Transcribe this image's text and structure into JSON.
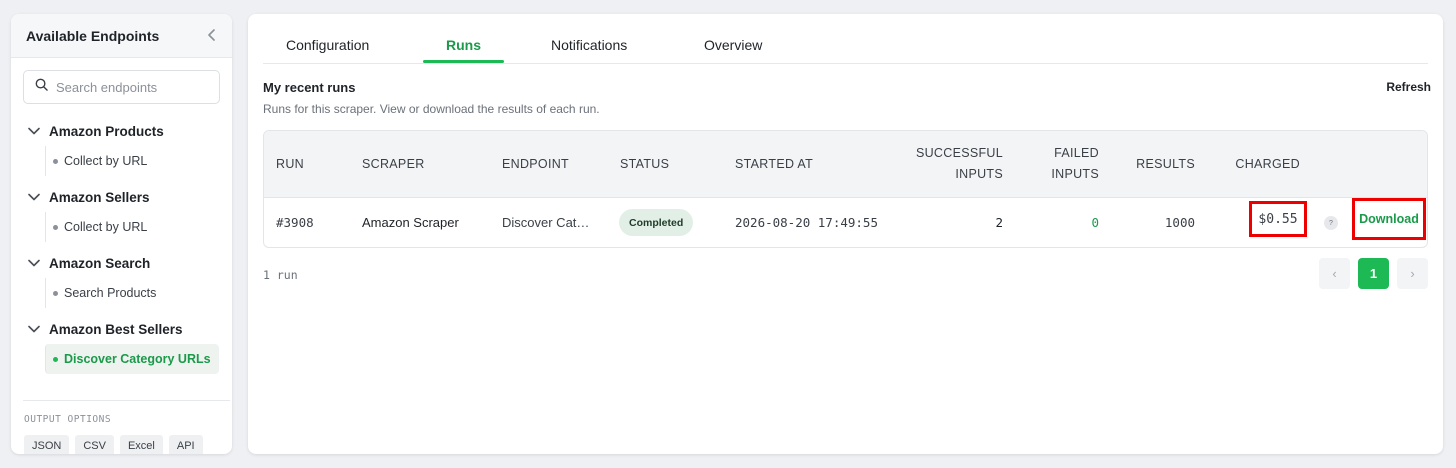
{
  "sidebar": {
    "title": "Available Endpoints",
    "search_placeholder": "Search endpoints",
    "groups": [
      {
        "label": "Amazon Products",
        "items": [
          {
            "label": "Collect by URL",
            "active": false
          }
        ]
      },
      {
        "label": "Amazon Sellers",
        "items": [
          {
            "label": "Collect by URL",
            "active": false
          }
        ]
      },
      {
        "label": "Amazon Search",
        "items": [
          {
            "label": "Search Products",
            "active": false
          }
        ]
      },
      {
        "label": "Amazon Best Sellers",
        "items": [
          {
            "label": "Discover Category URLs",
            "active": true
          }
        ]
      }
    ],
    "output_options_label": "OUTPUT OPTIONS",
    "output_options": [
      "JSON",
      "CSV",
      "Excel",
      "API"
    ]
  },
  "tabs": [
    {
      "label": "Configuration",
      "active": false
    },
    {
      "label": "Runs",
      "active": true
    },
    {
      "label": "Notifications",
      "active": false
    },
    {
      "label": "Overview",
      "active": false
    }
  ],
  "runs": {
    "title": "My recent runs",
    "subtitle": "Runs for this scraper. View or download the results of each run.",
    "refresh_label": "Refresh",
    "columns": {
      "run": "RUN",
      "scraper": "SCRAPER",
      "endpoint": "ENDPOINT",
      "status": "STATUS",
      "started_at": "STARTED AT",
      "successful_1": "SUCCESSFUL",
      "successful_2": "INPUTS",
      "failed_1": "FAILED",
      "failed_2": "INPUTS",
      "results": "RESULTS",
      "charged": "CHARGED"
    },
    "rows": [
      {
        "run": "#3908",
        "scraper": "Amazon Scraper",
        "endpoint": "Discover Cat…",
        "status": "Completed",
        "started_at": "2026-08-20 17:49:55",
        "successful_inputs": "2",
        "failed_inputs": "0",
        "results": "1000",
        "charged": "$0.55",
        "help": "?",
        "action": "Download"
      }
    ],
    "run_count": "1 run",
    "pagination": {
      "prev": "‹",
      "current": "1",
      "next": "›"
    }
  },
  "colors": {
    "accent": "#1db954",
    "accent_text": "#1a9a4a",
    "highlight_border": "#ee0000"
  }
}
